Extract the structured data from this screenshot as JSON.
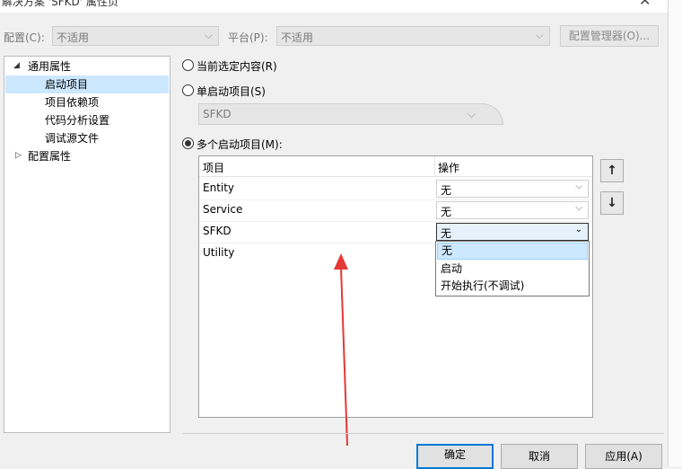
{
  "window": {
    "title": "解决方案 'SFKD' 属性页",
    "close_glyph": "✕"
  },
  "config_row": {
    "config_label": "配置(C):",
    "config_value": "不适用",
    "platform_label": "平台(P):",
    "platform_value": "不适用",
    "manager_button": "配置管理器(O)..."
  },
  "tree": {
    "common": "通用属性",
    "items": [
      "启动项目",
      "项目依赖项",
      "代码分析设置",
      "调试源文件"
    ],
    "config": "配置属性"
  },
  "startup": {
    "current_selection": "当前选定内容(R)",
    "single": "单启动项目(S)",
    "single_value": "SFKD",
    "multiple": "多个启动项目(M):"
  },
  "grid": {
    "col_project": "项目",
    "col_action": "操作",
    "rows": [
      {
        "project": "Entity",
        "action": "无"
      },
      {
        "project": "Service",
        "action": "无"
      },
      {
        "project": "SFKD",
        "action": "无"
      },
      {
        "project": "Utility",
        "action": ""
      }
    ]
  },
  "dropdown": {
    "options": [
      "无",
      "启动",
      "开始执行(不调试)"
    ],
    "selected": "无"
  },
  "buttons": {
    "up": "↑",
    "down": "↓",
    "ok": "确定",
    "cancel": "取消",
    "apply": "应用(A)"
  },
  "colors": {
    "selection": "#cce8ff",
    "focus_border": "#0078d7",
    "annotation_arrow": "#e53935"
  }
}
